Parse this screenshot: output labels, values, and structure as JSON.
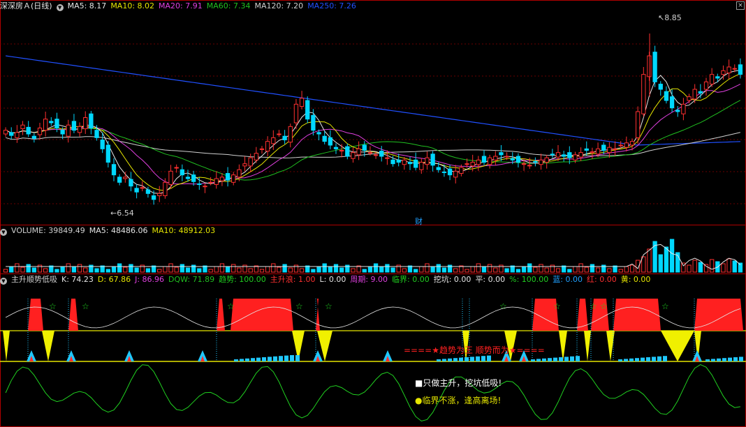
{
  "header_main": {
    "title": "深深房Ａ(日线)",
    "items": [
      {
        "label": "MA5: 8.17",
        "color": "#e6e6e6"
      },
      {
        "label": "MA10: 8.02",
        "color": "#e6e600"
      },
      {
        "label": "MA20: 7.91",
        "color": "#e040e0"
      },
      {
        "label": "MA60: 7.34",
        "color": "#20c020"
      },
      {
        "label": "MA120: 7.20",
        "color": "#d0d0d0"
      },
      {
        "label": "MA250: 7.26",
        "color": "#2050ff"
      }
    ]
  },
  "header_volume": {
    "items": [
      {
        "label": "VOLUME: 39849.49",
        "color": "#d0d0d0"
      },
      {
        "label": "MA5: 48486.06",
        "color": "#e6e6e6"
      },
      {
        "label": "MA10: 48912.03",
        "color": "#e6e600"
      }
    ]
  },
  "header_indicator": {
    "items": [
      {
        "label": "主升顺势低吸",
        "color": "#d0d0d0"
      },
      {
        "label": "K: 74.23",
        "color": "#e6e6e6"
      },
      {
        "label": "D: 67.86",
        "color": "#e6e600"
      },
      {
        "label": "J: 86.96",
        "color": "#e040e0"
      },
      {
        "label": "DQW: 71.89",
        "color": "#20c020"
      },
      {
        "label": "趋势: 100.00",
        "color": "#20d020"
      },
      {
        "label": "主升浪: 1.00",
        "color": "#ff3030"
      },
      {
        "label": "L: 0.00",
        "color": "#e6e6e6"
      },
      {
        "label": "周期: 9.00",
        "color": "#e040e0"
      },
      {
        "label": "临界: 0.00",
        "color": "#20d020"
      },
      {
        "label": "挖坑: 0.00",
        "color": "#e6e6e6"
      },
      {
        "label": "平: 0.00",
        "color": "#e6e6e6"
      },
      {
        "label": "%: 100.00",
        "color": "#20d020"
      },
      {
        "label": "蓝: 0.00",
        "color": "#20a0ff"
      },
      {
        "label": "红: 0.00",
        "color": "#ff3030"
      },
      {
        "label": "黄: 0.00",
        "color": "#e6e600"
      }
    ]
  },
  "annotations": {
    "high_label": "8.85",
    "low_label": "6.54",
    "event_label": "财",
    "indicator_text": "====★趋势为王 顺势而为★====",
    "legend1": "■只做主升，挖坑低吸!",
    "legend2": "●临界不涨，逢高离场!"
  },
  "chart_data": {
    "type": "candlestick",
    "high": 8.85,
    "low": 6.54,
    "price_axis_range": [
      6.3,
      9.15
    ],
    "colors": {
      "up": "#ff3030",
      "down": "#00d8ff",
      "ma5": "#e6e6e6",
      "ma10": "#e6e600",
      "ma20": "#e040e0",
      "ma60": "#20c020",
      "ma120": "#d0d0d0",
      "ma250": "#2050ff"
    },
    "closes": [
      7.55,
      7.48,
      7.52,
      7.62,
      7.5,
      7.44,
      7.58,
      7.7,
      7.65,
      7.58,
      7.5,
      7.62,
      7.55,
      7.6,
      7.72,
      7.58,
      7.45,
      7.3,
      7.12,
      6.95,
      6.85,
      6.92,
      6.8,
      6.72,
      6.78,
      6.7,
      6.62,
      6.7,
      6.85,
      7.0,
      7.05,
      6.95,
      6.9,
      6.86,
      6.82,
      6.8,
      6.85,
      6.9,
      6.92,
      6.88,
      6.95,
      7.02,
      7.1,
      7.18,
      7.24,
      7.3,
      7.4,
      7.45,
      7.5,
      7.42,
      7.6,
      7.9,
      7.98,
      7.7,
      7.55,
      7.5,
      7.4,
      7.35,
      7.3,
      7.28,
      7.2,
      7.25,
      7.3,
      7.28,
      7.25,
      7.22,
      7.2,
      7.18,
      7.1,
      7.12,
      7.15,
      7.1,
      7.05,
      7.12,
      7.18,
      7.08,
      7.02,
      6.98,
      6.95,
      7.0,
      7.05,
      7.1,
      7.12,
      7.15,
      7.12,
      7.18,
      7.2,
      7.22,
      7.2,
      7.15,
      7.12,
      7.1,
      7.08,
      7.12,
      7.15,
      7.18,
      7.22,
      7.25,
      7.2,
      7.18,
      7.22,
      7.25,
      7.28,
      7.26,
      7.3,
      7.28,
      7.32,
      7.3,
      7.35,
      7.38,
      7.4,
      7.8,
      8.3,
      8.55,
      8.2,
      8.1,
      7.95,
      7.85,
      7.8,
      7.9,
      8.0,
      8.1,
      8.05,
      8.2,
      8.3,
      8.25,
      8.35,
      8.4,
      8.38,
      8.3
    ],
    "volume": {
      "ma5": 48486.06,
      "ma10": 48912.03,
      "last": 39849.49
    },
    "indicator": {
      "K": 74.23,
      "D": 67.86,
      "J": 86.96,
      "DQW": 71.89,
      "trend": 100.0,
      "main_wave": 1.0
    }
  }
}
